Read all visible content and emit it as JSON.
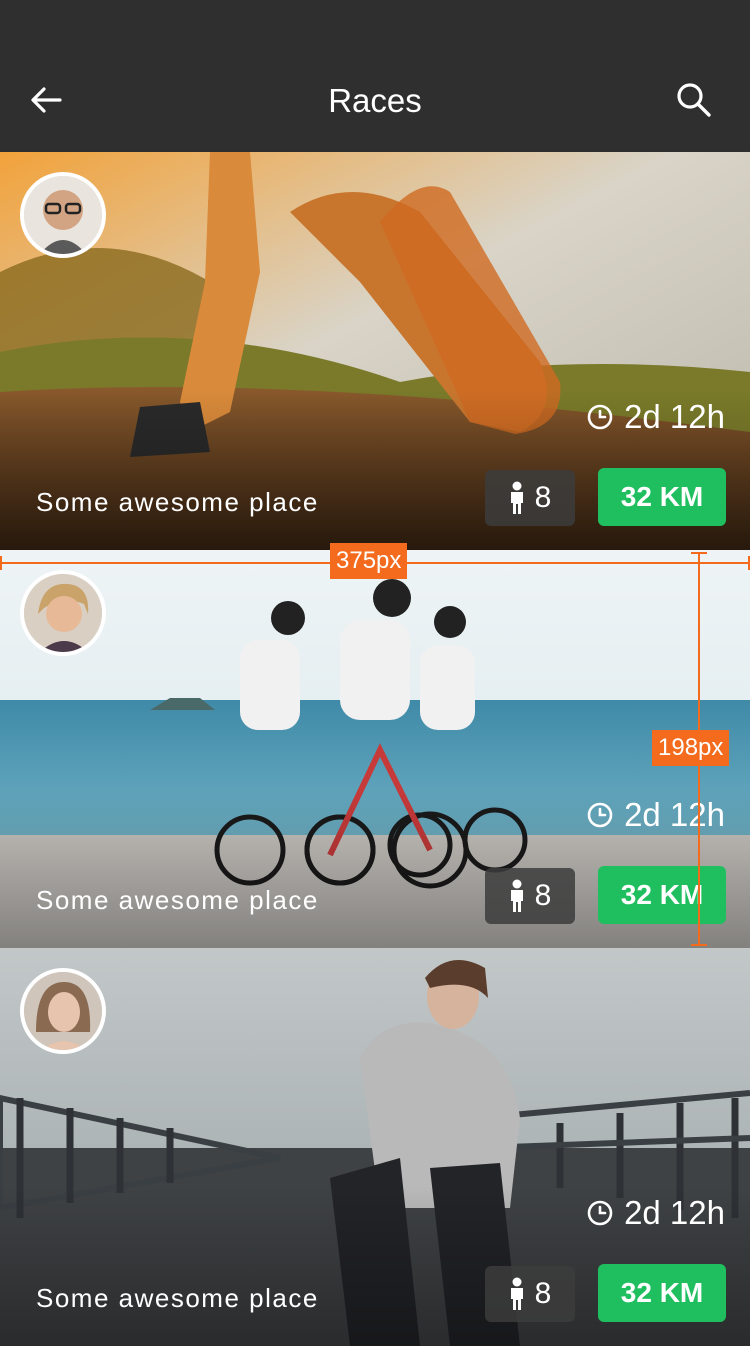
{
  "header": {
    "title": "Races"
  },
  "cards": [
    {
      "place": "Some awesome place",
      "duration": "2d 12h",
      "participants": "8",
      "distance": "32 KM"
    },
    {
      "place": "Some awesome place",
      "duration": "2d 12h",
      "participants": "8",
      "distance": "32 KM"
    },
    {
      "place": "Some awesome place",
      "duration": "2d 12h",
      "participants": "8",
      "distance": "32 KM"
    }
  ],
  "overlay": {
    "width_label": "375px",
    "height_label": "198px"
  },
  "colors": {
    "accent": "#1fbf5f",
    "header_bg": "#2f2f2f",
    "measure": "#f46b1d"
  },
  "icons": {
    "back": "arrow-left-icon",
    "search": "search-icon",
    "clock": "clock-icon",
    "person": "person-icon"
  }
}
